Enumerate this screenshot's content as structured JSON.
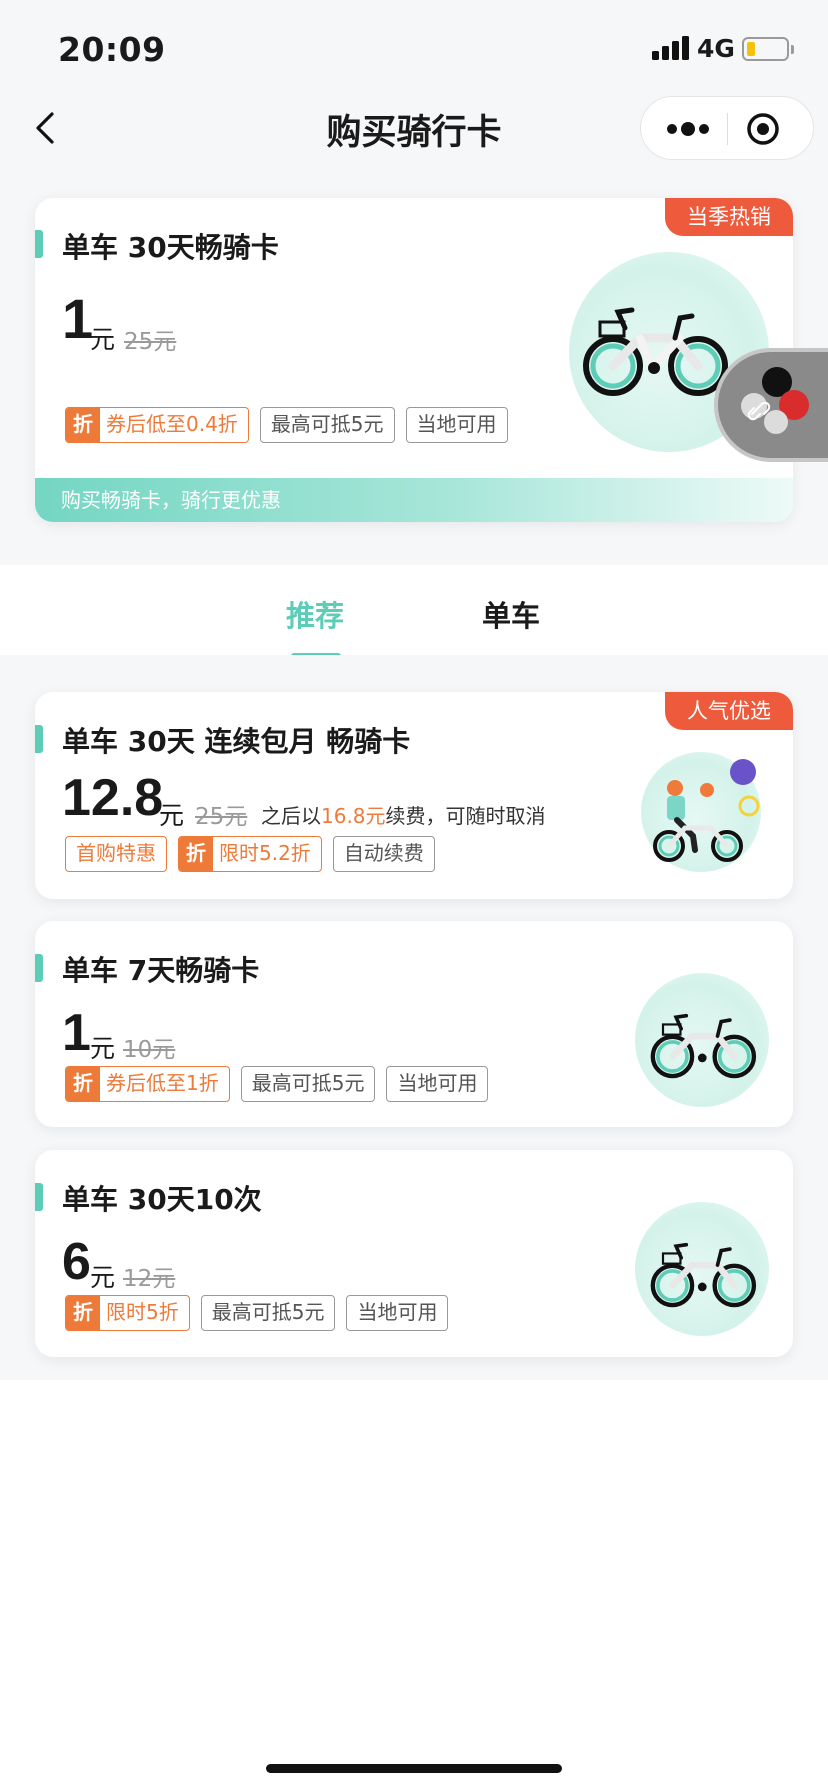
{
  "status_bar": {
    "time": "20:09",
    "network": "4G"
  },
  "nav": {
    "title": "购买骑行卡"
  },
  "featured": {
    "badge": "当季热销",
    "title": "单车 30天畅骑卡",
    "price": "1",
    "unit": "元",
    "original": "25元",
    "tags": {
      "zhe": "折",
      "discount": "券后低至0.4折",
      "deduct": "最高可抵5元",
      "local": "当地可用"
    },
    "footer": "购买畅骑卡，骑行更优惠"
  },
  "tabs": [
    "推荐",
    "单车"
  ],
  "cards": [
    {
      "badge": "人气优选",
      "title": "单车 30天 连续包月 畅骑卡",
      "price": "12.8",
      "unit": "元",
      "original": "25元",
      "renew_prefix": "之后以",
      "renew_price": "16.8元",
      "renew_suffix": "续费，可随时取消",
      "tags": {
        "first": "首购特惠",
        "zhe": "折",
        "discount": "限时5.2折",
        "auto": "自动续费"
      }
    },
    {
      "title": "单车 7天畅骑卡",
      "price": "1",
      "unit": "元",
      "original": "10元",
      "tags": {
        "zhe": "折",
        "discount": "券后低至1折",
        "deduct": "最高可抵5元",
        "local": "当地可用"
      }
    },
    {
      "title": "单车 30天10次",
      "price": "6",
      "unit": "元",
      "original": "12元",
      "tags": {
        "zhe": "折",
        "discount": "限时5折",
        "deduct": "最高可抵5元",
        "local": "当地可用"
      }
    }
  ],
  "colors": {
    "accent": "#5ecdb7",
    "orange": "#ee7a3a",
    "badge_red": "#ee5b3c"
  },
  "icons": [
    "back-chevron-icon",
    "more-dots-icon",
    "close-target-icon",
    "signal-icon",
    "battery-icon",
    "bike-icon",
    "cyclist-icon",
    "link-icon"
  ]
}
